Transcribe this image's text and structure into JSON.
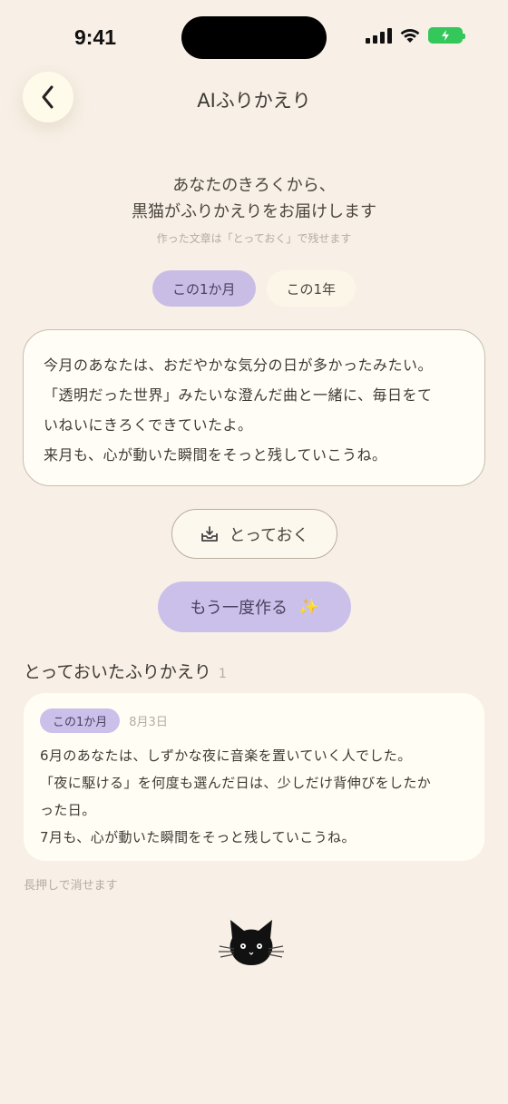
{
  "status": {
    "time": "9:41"
  },
  "header": {
    "title": "AIふりかえり"
  },
  "intro": {
    "line1": "あなたのきろくから、",
    "line2": "黒猫がふりかえりをお届けします",
    "note": "作った文章は「とっておく」で残せます"
  },
  "tabs": [
    {
      "label": "この1か月",
      "active": true
    },
    {
      "label": "この1年",
      "active": false
    }
  ],
  "result": {
    "lines": [
      "今月のあなたは、おだやかな気分の日が多かったみたい。",
      "「透明だった世界」みたいな澄んだ曲と一緒に、毎日をて",
      "いねいにきろくできていたよ。",
      "来月も、心が動いた瞬間をそっと残していこうね。"
    ]
  },
  "actions": {
    "save_label": "とっておく",
    "regen_label": "もう一度作る",
    "regen_emoji": "✨"
  },
  "saved": {
    "title": "とっておいたふりかえり",
    "count": "1",
    "items": [
      {
        "tag": "この1か月",
        "date": "8月3日",
        "lines": [
          "6月のあなたは、しずかな夜に音楽を置いていく人でした。",
          "「夜に駆ける」を何度も選んだ日は、少しだけ背伸びをしたか",
          "った日。",
          "7月も、心が動いた瞬間をそっと残していこうね。"
        ]
      }
    ],
    "hint": "長押しで消せます"
  },
  "colors": {
    "background": "#f8f0e6",
    "accent": "#cbc0ea",
    "battery": "#34c759"
  },
  "icons": {
    "back": "chevron-left-icon",
    "save": "inbox-download-icon",
    "mascot": "black-cat-icon"
  }
}
